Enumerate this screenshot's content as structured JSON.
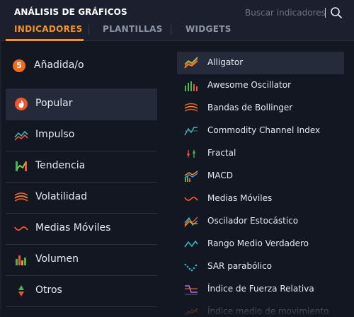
{
  "header": {
    "title": "ANÁLISIS DE GRÁFICOS",
    "search_placeholder": "Buscar indicadores",
    "tabs": [
      {
        "label": "INDICADORES",
        "active": true
      },
      {
        "label": "PLANTILLAS",
        "active": false
      },
      {
        "label": "WIDGETS",
        "active": false
      }
    ]
  },
  "added": {
    "count": "5",
    "label": "Añadida/o"
  },
  "categories": [
    {
      "label": "Popular",
      "icon": "flame-icon",
      "active": true
    },
    {
      "label": "Impulso",
      "icon": "momentum-icon",
      "active": false
    },
    {
      "label": "Tendencia",
      "icon": "trend-icon",
      "active": false
    },
    {
      "label": "Volatilidad",
      "icon": "volatility-icon",
      "active": false
    },
    {
      "label": "Medias Móviles",
      "icon": "moving-average-icon",
      "active": false
    },
    {
      "label": "Volumen",
      "icon": "volume-icon",
      "active": false
    },
    {
      "label": "Otros",
      "icon": "other-icon",
      "active": false
    }
  ],
  "indicators": [
    {
      "label": "Alligator",
      "icon": "alligator-icon",
      "active": true
    },
    {
      "label": "Awesome Oscillator",
      "icon": "awesome-oscillator-icon",
      "active": false
    },
    {
      "label": "Bandas de Bollinger",
      "icon": "bollinger-icon",
      "active": false
    },
    {
      "label": "Commodity Channel Index",
      "icon": "cci-icon",
      "active": false
    },
    {
      "label": "Fractal",
      "icon": "fractal-icon",
      "active": false
    },
    {
      "label": "MACD",
      "icon": "macd-icon",
      "active": false
    },
    {
      "label": "Medias Móviles",
      "icon": "moving-average-icon",
      "active": false
    },
    {
      "label": "Oscilador Estocástico",
      "icon": "stochastic-icon",
      "active": false
    },
    {
      "label": "Rango Medio Verdadero",
      "icon": "atr-icon",
      "active": false
    },
    {
      "label": "SAR parabólico",
      "icon": "sar-icon",
      "active": false
    },
    {
      "label": "Índice de Fuerza Relativa",
      "icon": "rsi-icon",
      "active": false
    },
    {
      "label": "Índice medio de movimiento",
      "icon": "adx-icon",
      "active": false
    }
  ],
  "colors": {
    "accent": "#f7931a",
    "badge": "#f26a1b",
    "background": "#131722",
    "header": "#1b1f2e",
    "selected": "#252a3b"
  }
}
